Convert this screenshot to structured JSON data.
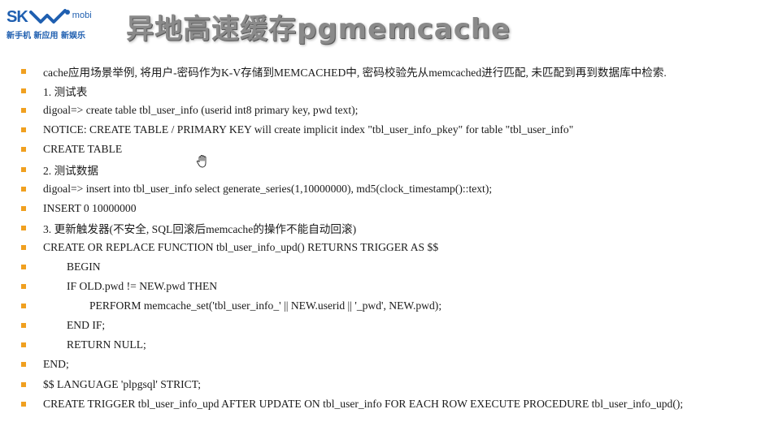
{
  "logo": {
    "brand": "SK",
    "suffix": "mobi",
    "tagline": "新手机 新应用 新娱乐"
  },
  "title": "异地高速缓存pgmemcache",
  "bullets": [
    {
      "text": "cache应用场景举例, 将用户-密码作为K-V存储到MEMCACHED中, 密码校验先从memcached进行匹配, 未匹配到再到数据库中检索."
    },
    {
      "text": "1. 测试表"
    },
    {
      "text": "digoal=> create table tbl_user_info (userid int8 primary key, pwd text);"
    },
    {
      "text": "NOTICE:  CREATE TABLE / PRIMARY KEY will create implicit index \"tbl_user_info_pkey\" for table \"tbl_user_info\""
    },
    {
      "text": "CREATE TABLE"
    },
    {
      "text": "2. 测试数据"
    },
    {
      "text": "digoal=> insert into tbl_user_info select generate_series(1,10000000), md5(clock_timestamp()::text);"
    },
    {
      "text": "INSERT 0 10000000"
    },
    {
      "text": "3. 更新触发器(不安全, SQL回滚后memcache的操作不能自动回滚)"
    },
    {
      "text": "CREATE OR REPLACE FUNCTION tbl_user_info_upd() RETURNS TRIGGER AS $$"
    },
    {
      "text": "BEGIN"
    },
    {
      "text": "IF OLD.pwd != NEW.pwd THEN"
    },
    {
      "text": "PERFORM memcache_set('tbl_user_info_' || NEW.userid || '_pwd', NEW.pwd);"
    },
    {
      "text": "END IF;"
    },
    {
      "text": "RETURN NULL;"
    },
    {
      "text": "END;"
    },
    {
      "text": "$$ LANGUAGE 'plpgsql' STRICT;"
    },
    {
      "text": "CREATE TRIGGER tbl_user_info_upd AFTER UPDATE ON tbl_user_info FOR EACH ROW EXECUTE PROCEDURE tbl_user_info_upd();"
    }
  ],
  "colors": {
    "bullet": "#f0a020",
    "brand": "#1f5fb0",
    "title": "#8a8a8a"
  },
  "icons": {
    "cursor": "hand-pointer-icon"
  }
}
